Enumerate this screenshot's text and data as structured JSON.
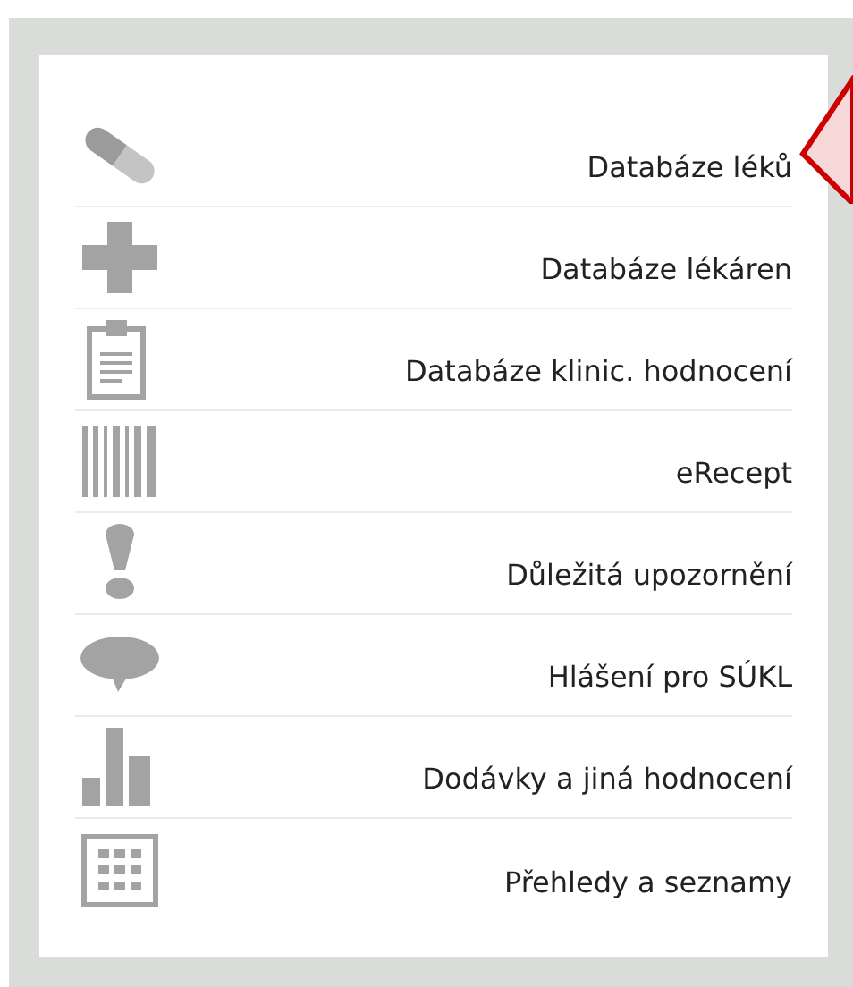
{
  "menu": {
    "items": [
      {
        "kind": "pill",
        "label": "Databáze léků"
      },
      {
        "kind": "cross",
        "label": "Databáze lékáren"
      },
      {
        "kind": "clipboard",
        "label": "Databáze klinic. hodnocení"
      },
      {
        "kind": "barcode",
        "label": "eRecept"
      },
      {
        "kind": "exclamation",
        "label": "Důležitá upozornění"
      },
      {
        "kind": "speech",
        "label": "Hlášení pro SÚKL"
      },
      {
        "kind": "bars",
        "label": "Dodávky a jiná hodnocení"
      },
      {
        "kind": "grid",
        "label": "Přehledy a seznamy"
      }
    ]
  }
}
